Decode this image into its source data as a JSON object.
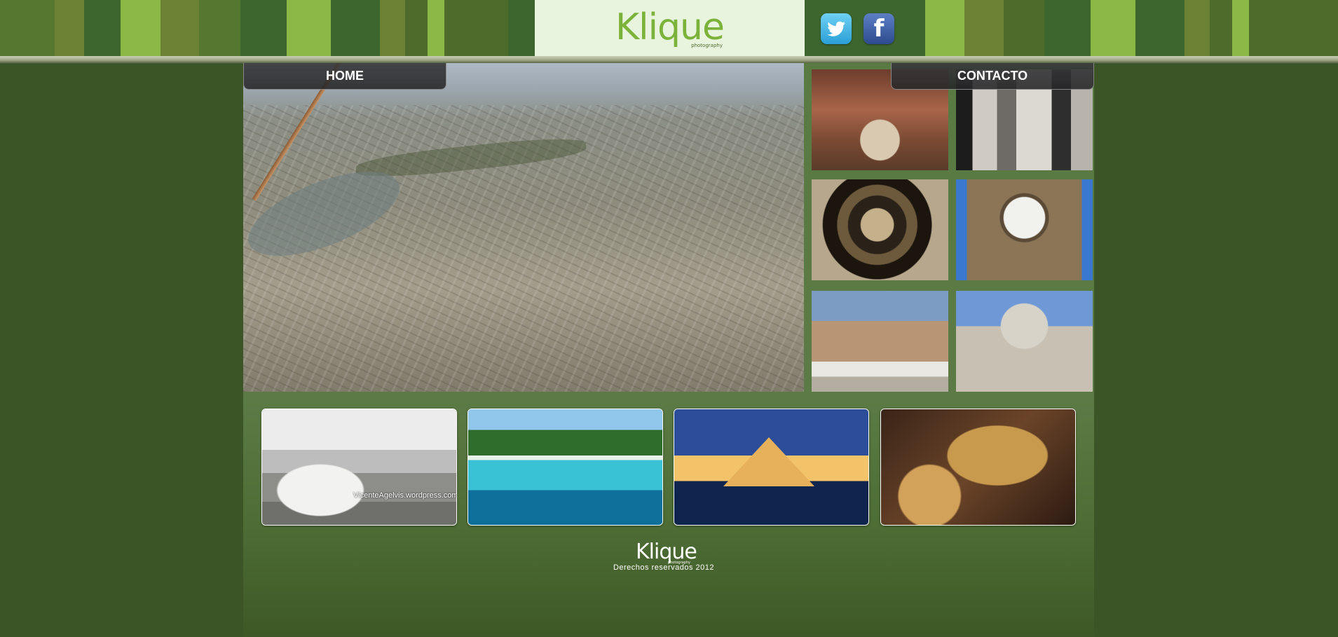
{
  "header": {
    "logo_text": "Klique",
    "logo_subtext": "photography",
    "stripe_colors": [
      "#56772f",
      "#6b8235",
      "#3d652e",
      "#8ab946",
      "#4e6b2c"
    ],
    "social": [
      {
        "name": "twitter",
        "icon": "twitter-bird-icon"
      },
      {
        "name": "facebook",
        "icon": "facebook-f-icon",
        "glyph": "f"
      }
    ]
  },
  "nav": {
    "home_label": "HOME",
    "contact_label": "CONTACTO"
  },
  "gallery": {
    "hero": "aerial-city-photo",
    "thumbnails": [
      "fresco-painting-photo",
      "arched-interior-photo",
      "globe-sculpture-photo",
      "clock-tower-photo",
      "city-rooftops-photo",
      "cathedral-photo"
    ],
    "featured": [
      {
        "name": "wedding-couple-photo",
        "watermark": "VicenteAgelvis.wordpress.com"
      },
      {
        "name": "tropical-beach-boat-photo"
      },
      {
        "name": "glass-pyramid-night-photo"
      },
      {
        "name": "food-platter-photo"
      }
    ]
  },
  "footer": {
    "logo_text": "Klique",
    "logo_subtext": "photography",
    "copyright": "Derechos reservados 2012"
  },
  "colors": {
    "page_background": "#3b5526",
    "content_background": "#5a7a43",
    "logo_green": "#7bb33a",
    "logo_box": "#e9f4df"
  }
}
